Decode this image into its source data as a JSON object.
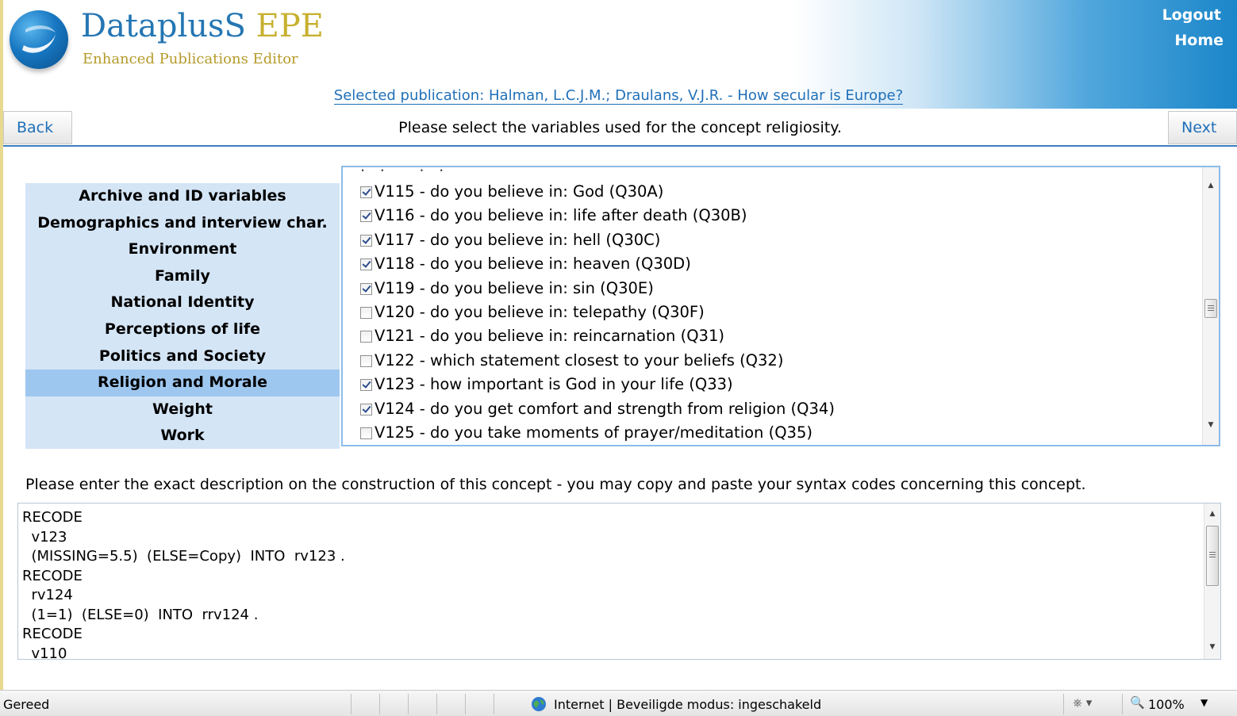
{
  "brand": {
    "title_main": "DataplusS",
    "title_accent": "EPE",
    "subtitle": "Enhanced Publications Editor"
  },
  "top_nav": {
    "logout": "Logout",
    "home": "Home"
  },
  "selected_publication": "Selected publication: Halman, L.C.J.M.; Draulans, V.J.R. - How secular is Europe?",
  "action_bar": {
    "back_label": "Back",
    "next_label": "Next",
    "instruction": "Please select the variables used for the concept religiosity."
  },
  "categories": [
    {
      "label": "Archive and ID variables",
      "active": false
    },
    {
      "label": "Demographics and interview char.",
      "active": false
    },
    {
      "label": "Environment",
      "active": false
    },
    {
      "label": "Family",
      "active": false
    },
    {
      "label": "National Identity",
      "active": false
    },
    {
      "label": "Perceptions of life",
      "active": false
    },
    {
      "label": "Politics and Society",
      "active": false
    },
    {
      "label": "Religion and Morale",
      "active": true
    },
    {
      "label": "Weight",
      "active": false
    },
    {
      "label": "Work",
      "active": false
    }
  ],
  "variables": [
    {
      "label": "V115 - do you believe in: God (Q30A)",
      "checked": true
    },
    {
      "label": "V116 - do you believe in: life after death (Q30B)",
      "checked": true
    },
    {
      "label": "V117 - do you believe in: hell (Q30C)",
      "checked": true
    },
    {
      "label": "V118 - do you believe in: heaven (Q30D)",
      "checked": true
    },
    {
      "label": "V119 - do you believe in: sin (Q30E)",
      "checked": true
    },
    {
      "label": "V120 - do you believe in: telepathy (Q30F)",
      "checked": false
    },
    {
      "label": "V121 - do you believe in: reincarnation (Q31)",
      "checked": false
    },
    {
      "label": "V122 - which statement closest to your beliefs (Q32)",
      "checked": false
    },
    {
      "label": "V123 - how important is God in your life (Q33)",
      "checked": true
    },
    {
      "label": "V124 - do you get comfort and strength from religion (Q34)",
      "checked": true
    },
    {
      "label": "V125 - do you take moments of prayer/meditation (Q35)",
      "checked": false
    }
  ],
  "variable_list_scroll_position": 0.5,
  "description_label": "Please enter the exact description on the construction of this concept - you may copy and paste your syntax codes concerning this concept.",
  "syntax_lines": [
    "RECODE",
    "  v123",
    "  (MISSING=5.5)  (ELSE=Copy)  INTO  rv123 .",
    "RECODE",
    "  rv124",
    "  (1=1)  (ELSE=0)  INTO  rrv124 .",
    "RECODE",
    "  v110"
  ],
  "syntax_scroll_position": 0.35,
  "status_bar": {
    "left_text": "Gereed",
    "zone_text": "Internet | Beveiligde modus: ingeschakeld",
    "zoom_text": "100%"
  },
  "colors": {
    "accent_blue": "#1f6fb8",
    "category_bg": "#d4e5f6",
    "category_active_bg": "#9ec7f0",
    "brand_gold": "#c7b02f"
  }
}
